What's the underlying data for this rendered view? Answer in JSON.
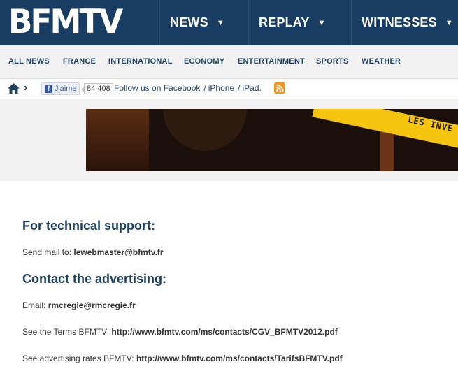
{
  "header": {
    "logo": "BFMTV",
    "nav": [
      {
        "label": "NEWS"
      },
      {
        "label": "REPLAY"
      },
      {
        "label": "WITNESSES"
      }
    ]
  },
  "subnav": [
    "ALL NEWS",
    "FRANCE",
    "INTERNATIONAL",
    "ECONOMY",
    "ENTERTAINMENT",
    "SPORTS",
    "WEATHER"
  ],
  "social": {
    "like_label": "J'aime",
    "like_count": "84 408",
    "follow_text": "Follow us on Facebook",
    "iphone": "iPhone",
    "ipad": "iPad",
    "separator": "/",
    "dot": "."
  },
  "banner": {
    "text": "LES INVE"
  },
  "content": {
    "support_heading": "For technical support:",
    "support_prefix": "Send mail to:",
    "support_email": "lewebmaster@bfmtv.fr",
    "advertising_heading": "Contact the advertising:",
    "email_prefix": "Email:",
    "email": "rmcregie@rmcregie.fr",
    "terms_prefix": "See the Terms BFMTV:",
    "terms_link": "http://www.bfmtv.com/ms/contacts/CGV_BFMTV2012.pdf",
    "rates_prefix": "See advertising rates BFMTV:",
    "rates_link": "http://www.bfmtv.com/ms/contacts/TarifsBFMTV.pdf"
  },
  "colors": {
    "header_bg": "#193d62",
    "accent_blue": "#1b3f63",
    "banner_yellow": "#f5c40f",
    "rss_orange": "#f7931e"
  },
  "icons": [
    "home-icon",
    "chevron-right-icon",
    "facebook-icon",
    "rss-icon",
    "caret-down-icon"
  ]
}
